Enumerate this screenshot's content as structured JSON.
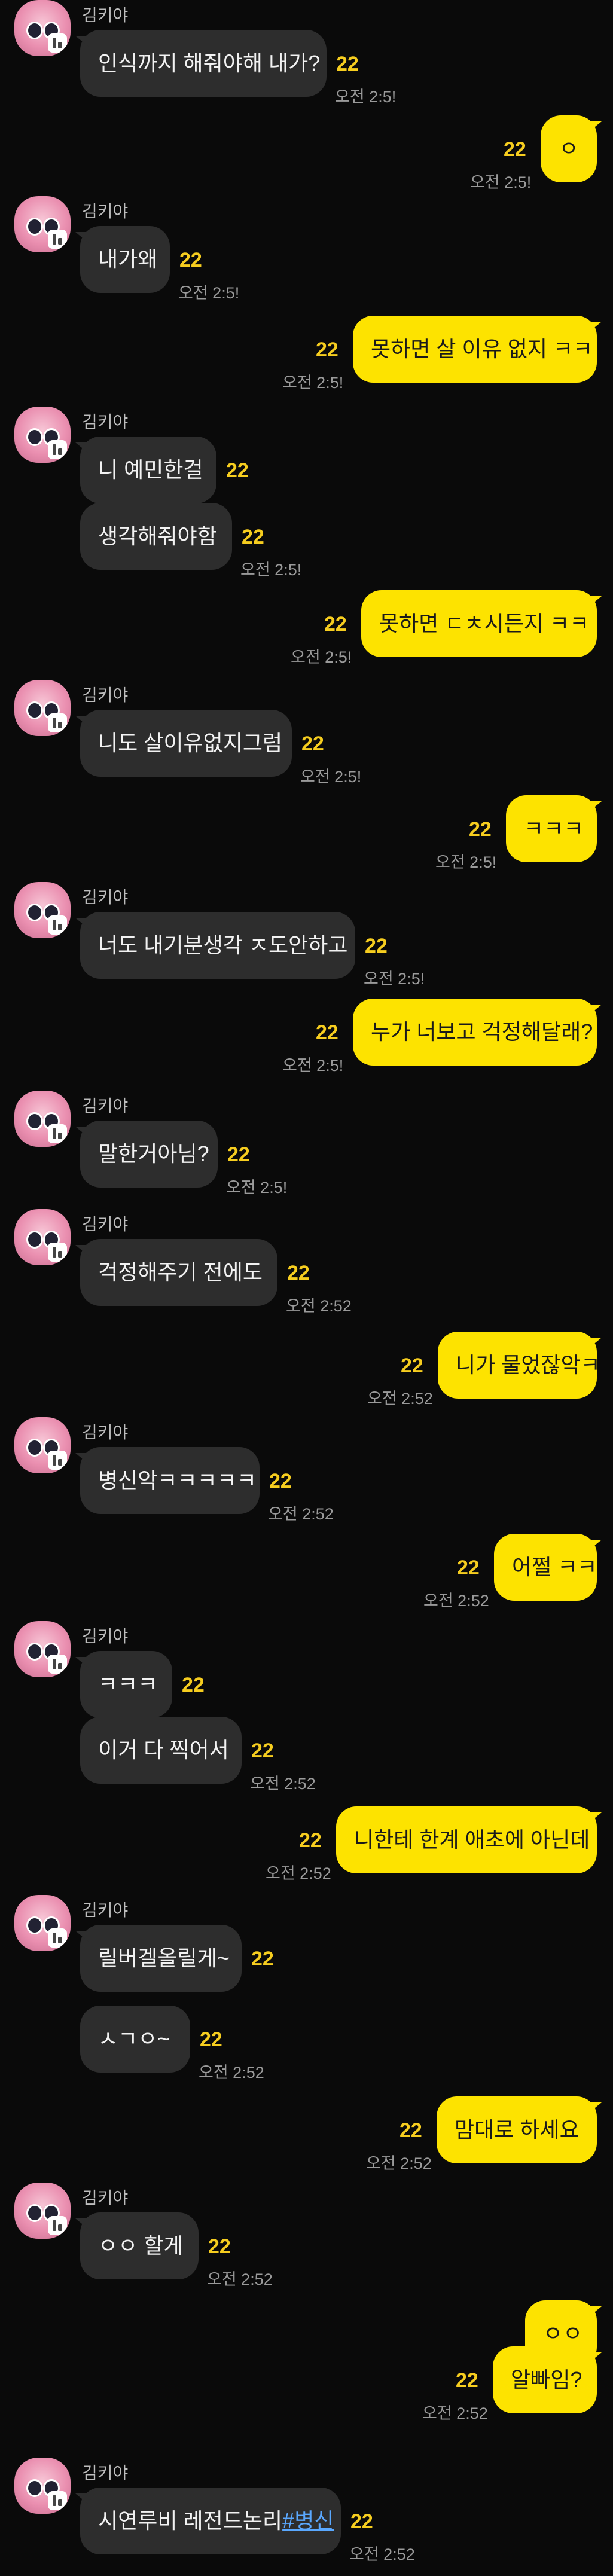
{
  "chat": {
    "sender_name": "김키야",
    "messages": [
      {
        "dir": "in",
        "text": "인식까지 해줘야해 내가?",
        "read": "22",
        "time": "오전 2:5!"
      },
      {
        "dir": "out",
        "text": "ㅇ",
        "read": "22",
        "time": "오전 2:5!"
      },
      {
        "dir": "in",
        "text": "내가왜",
        "read": "22",
        "time": "오전 2:5!"
      },
      {
        "dir": "out",
        "text": "못하면 살 이유 없지 ㅋㅋ",
        "read": "22",
        "time": "오전 2:5!"
      },
      {
        "dir": "in",
        "text": "니 예민한걸",
        "read": "22",
        "time": ""
      },
      {
        "dir": "in",
        "text": "생각해줘야함",
        "read": "22",
        "time": "오전 2:5!"
      },
      {
        "dir": "out",
        "text": "못하면 ㄷㅊ시든지 ㅋㅋ",
        "read": "22",
        "time": "오전 2:5!"
      },
      {
        "dir": "in",
        "text": "니도 살이유없지그럼",
        "read": "22",
        "time": "오전 2:5!"
      },
      {
        "dir": "out",
        "text": "ㅋㅋㅋ",
        "read": "22",
        "time": "오전 2:5!"
      },
      {
        "dir": "in",
        "text": "너도 내기분생각 ㅈ도안하고",
        "read": "22",
        "time": "오전 2:5!"
      },
      {
        "dir": "out",
        "text": "누가 너보고 걱정해달래?",
        "read": "22",
        "time": "오전 2:5!"
      },
      {
        "dir": "in",
        "text": "말한거아님?",
        "read": "22",
        "time": "오전 2:5!"
      },
      {
        "dir": "in",
        "text": "걱정해주기 전에도",
        "read": "22",
        "time": "오전 2:52"
      },
      {
        "dir": "out",
        "text": "니가 물었잖악ㅋ",
        "read": "22",
        "time": "오전 2:52"
      },
      {
        "dir": "in",
        "text": "병신악ㅋㅋㅋㅋㅋ",
        "read": "22",
        "time": "오전 2:52"
      },
      {
        "dir": "out",
        "text": "어쩔 ㅋㅋ",
        "read": "22",
        "time": "오전 2:52"
      },
      {
        "dir": "in",
        "text": "ㅋㅋㅋ",
        "read": "22",
        "time": ""
      },
      {
        "dir": "in",
        "text": "이거 다 찍어서",
        "read": "22",
        "time": "오전 2:52"
      },
      {
        "dir": "out",
        "text": "니한테 한계 애초에 아닌데",
        "read": "22",
        "time": "오전 2:52"
      },
      {
        "dir": "in",
        "text": "릴버겔올릴게~",
        "read": "22",
        "time": ""
      },
      {
        "dir": "in",
        "text": "ㅅㄱㅇ~",
        "read": "22",
        "time": "오전 2:52"
      },
      {
        "dir": "out",
        "text": "맘대로 하세요",
        "read": "22",
        "time": "오전 2:52"
      },
      {
        "dir": "in",
        "text": "ㅇㅇ 할게",
        "read": "22",
        "time": "오전 2:52"
      },
      {
        "dir": "out",
        "text": "ㅇㅇ",
        "read": "",
        "time": ""
      },
      {
        "dir": "out",
        "text": "알빠임?",
        "read": "22",
        "time": "오전 2:52"
      },
      {
        "dir": "in",
        "text": "시연루비 레전드논리",
        "hashtag": "#병신",
        "read": "22",
        "time": "오전 2:52"
      }
    ]
  }
}
